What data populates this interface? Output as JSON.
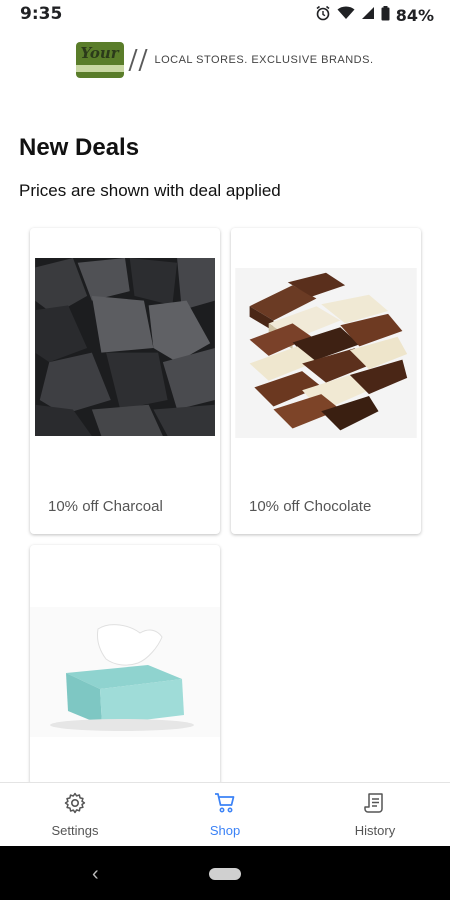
{
  "status_bar": {
    "time": "9:35",
    "battery": "84%"
  },
  "header": {
    "logo_text": "Your",
    "tagline": "LOCAL STORES. EXCLUSIVE BRANDS."
  },
  "main": {
    "title": "New Deals",
    "subtitle": "Prices are shown with deal applied",
    "deals": [
      {
        "label": "10% off Charcoal",
        "image": "charcoal-image"
      },
      {
        "label": "10% off Chocolate",
        "image": "chocolate-image"
      },
      {
        "label": "",
        "image": "tissue-box-image"
      }
    ]
  },
  "bottom_nav": {
    "items": [
      {
        "label": "Settings",
        "icon": "gear-icon",
        "active": false
      },
      {
        "label": "Shop",
        "icon": "cart-icon",
        "active": true
      },
      {
        "label": "History",
        "icon": "receipt-icon",
        "active": false
      }
    ]
  },
  "colors": {
    "accent": "#3b82f6",
    "brand_green": "#5a7d2a"
  }
}
